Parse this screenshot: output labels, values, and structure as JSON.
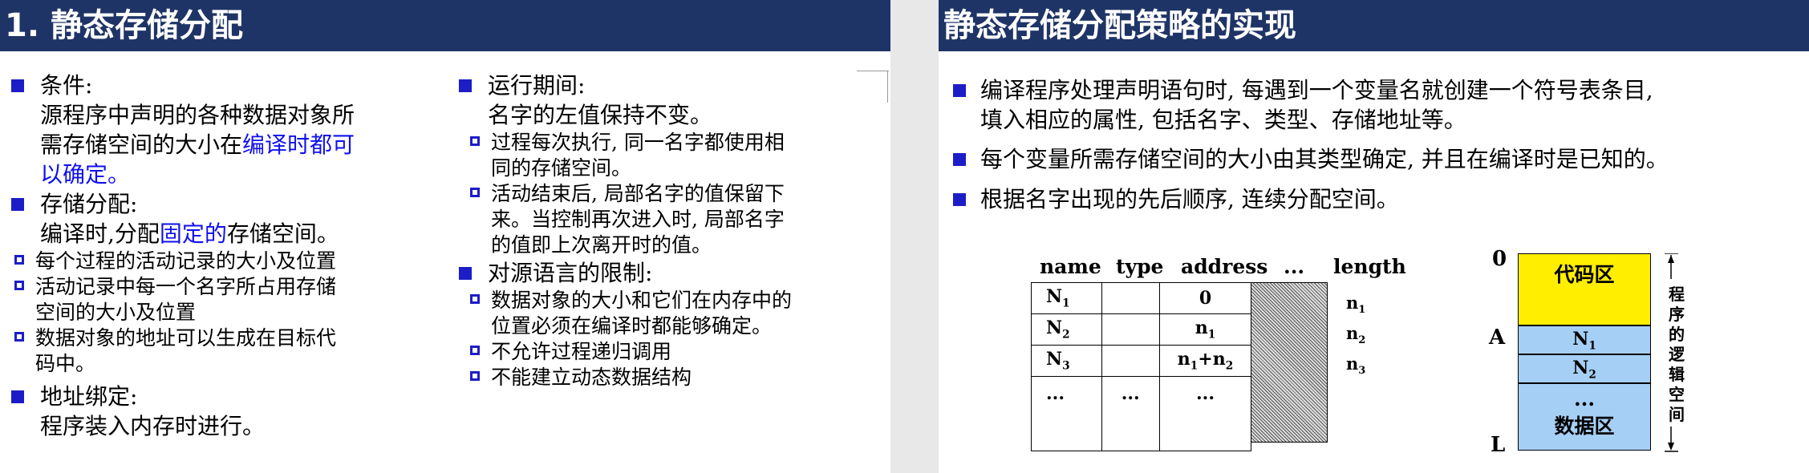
{
  "slide1": {
    "title": "1. 静态存储分配",
    "left": {
      "b1": {
        "label": "条件:",
        "l1": "源程序中声明的各种数据对象所",
        "l2a": "需存储空间的大小在",
        "l2b": "编译时都可",
        "l3": "以确定。"
      },
      "b2": {
        "label": "存储分配:",
        "l1a": "编译时,分配",
        "l1b": "固定的",
        "l1c": "存储空间。",
        "s1": "每个过程的活动记录的大小及位置",
        "s2a": "活动记录中每一个名字所占用存储",
        "s2b": "空间的大小及位置",
        "s3a": "数据对象的地址可以生成在目标代",
        "s3b": "码中。"
      },
      "b3": {
        "label": "地址绑定:",
        "l1": "程序装入内存时进行。"
      }
    },
    "right": {
      "b1": {
        "label": "运行期间:",
        "l1": "名字的左值保持不变。",
        "s1a": "过程每次执行, 同一名字都使用相",
        "s1b": "同的存储空间。",
        "s2a": "活动结束后, 局部名字的值保留下",
        "s2b": "来。当控制再次进入时, 局部名字",
        "s2c": "的值即上次离开时的值。"
      },
      "b2": {
        "label": "对源语言的限制:",
        "s1a": "数据对象的大小和它们在内存中的",
        "s1b": "位置必须在编译时都能够确定。",
        "s2": "不允许过程递归调用",
        "s3": "不能建立动态数据结构"
      }
    }
  },
  "slide2": {
    "title": "静态存储分配策略的实现",
    "bullets": {
      "b1a": "编译程序处理声明语句时, 每遇到一个变量名就创建一个符号表条目,",
      "b1b": "填入相应的属性, 包括名字、类型、存储地址等。",
      "b2": "每个变量所需存储空间的大小由其类型确定, 并且在编译时是已知的。",
      "b3": "根据名字出现的先后顺序, 连续分配空间。"
    },
    "table": {
      "headers": {
        "name": "name",
        "type": "type",
        "address": "address",
        "dots": "...",
        "length": "length"
      },
      "rows": [
        {
          "name": "N",
          "name_sub": "1",
          "address": "0",
          "len": "n",
          "len_sub": "1"
        },
        {
          "name": "N",
          "name_sub": "2",
          "address": "n",
          "address_sub": "1",
          "len": "n",
          "len_sub": "2"
        },
        {
          "name": "N",
          "name_sub": "3",
          "address": "n",
          "address_sub": "1",
          "address_mid": "+n",
          "address_sub2": "2",
          "len": "n",
          "len_sub": "3"
        },
        {
          "name": "...",
          "type": "...",
          "address": "..."
        }
      ]
    },
    "memory": {
      "label_0": "0",
      "label_A": "A",
      "label_L": "L",
      "code": "代码区",
      "n1": "N",
      "n1_sub": "1",
      "n2": "N",
      "n2_sub": "2",
      "dots": "...",
      "data": "数据区",
      "side": [
        "程",
        "序",
        "的",
        "逻",
        "辑",
        "空",
        "间"
      ],
      "colors": {
        "code": "#ffee00",
        "data": "#a6cff5"
      }
    }
  }
}
